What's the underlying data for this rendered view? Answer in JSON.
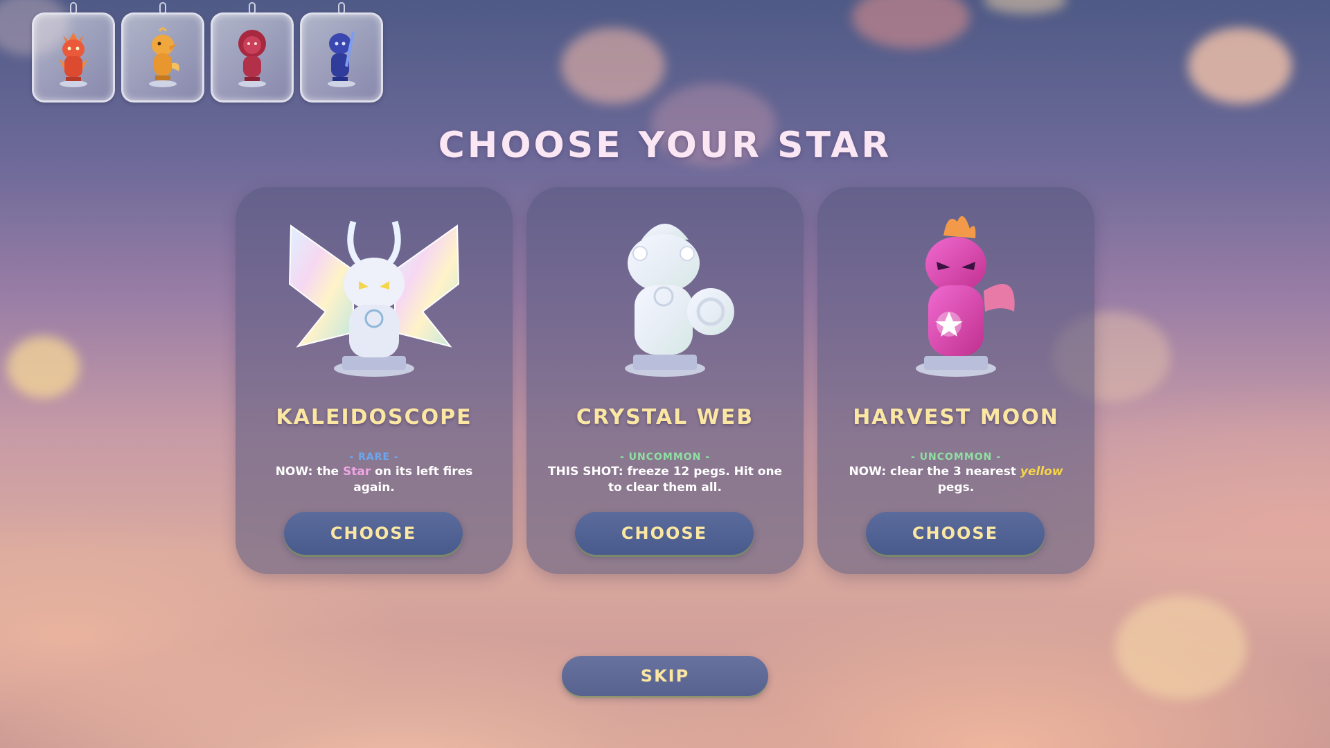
{
  "collection": {
    "slots": [
      {
        "icon": "red-dragon-figure-icon",
        "color": "#e2553d"
      },
      {
        "icon": "gold-duck-figure-icon",
        "color": "#e7a23a"
      },
      {
        "icon": "crimson-lion-figure-icon",
        "color": "#b8334a"
      },
      {
        "icon": "blue-knight-figure-icon",
        "color": "#3d4ab0"
      }
    ]
  },
  "title": "CHOOSE YOUR STAR",
  "cards": [
    {
      "name": "KALEIDOSCOPE",
      "rarity": "- RARE -",
      "rarity_color": "#6aa8f0",
      "desc_before": "NOW: the ",
      "desc_highlight": "Star",
      "desc_highlight_color": "#f1a6e4",
      "desc_after": " on its left fires again.",
      "button": "CHOOSE",
      "icon": "kaleidoscope-moth-figure-icon"
    },
    {
      "name": "CRYSTAL WEB",
      "rarity": "- UNCOMMON -",
      "rarity_color": "#8fe0a2",
      "desc_before": "THIS SHOT: freeze 12 pegs. Hit one to clear them all.",
      "desc_highlight": "",
      "desc_highlight_color": "#ffffff",
      "desc_after": "",
      "button": "CHOOSE",
      "icon": "crystal-chameleon-figure-icon"
    },
    {
      "name": "HARVEST MOON",
      "rarity": "- UNCOMMON -",
      "rarity_color": "#8fe0a2",
      "desc_before": "NOW: clear the 3 nearest ",
      "desc_highlight": "yellow",
      "desc_highlight_color": "#f7d54a",
      "desc_after": " pegs.",
      "button": "CHOOSE",
      "icon": "pink-phoenix-figure-icon"
    }
  ],
  "skip_label": "SKIP",
  "colors": {
    "accent_text": "#fbe7a2",
    "button_bg": "#4f5f90",
    "title": "#fbe6f4"
  }
}
